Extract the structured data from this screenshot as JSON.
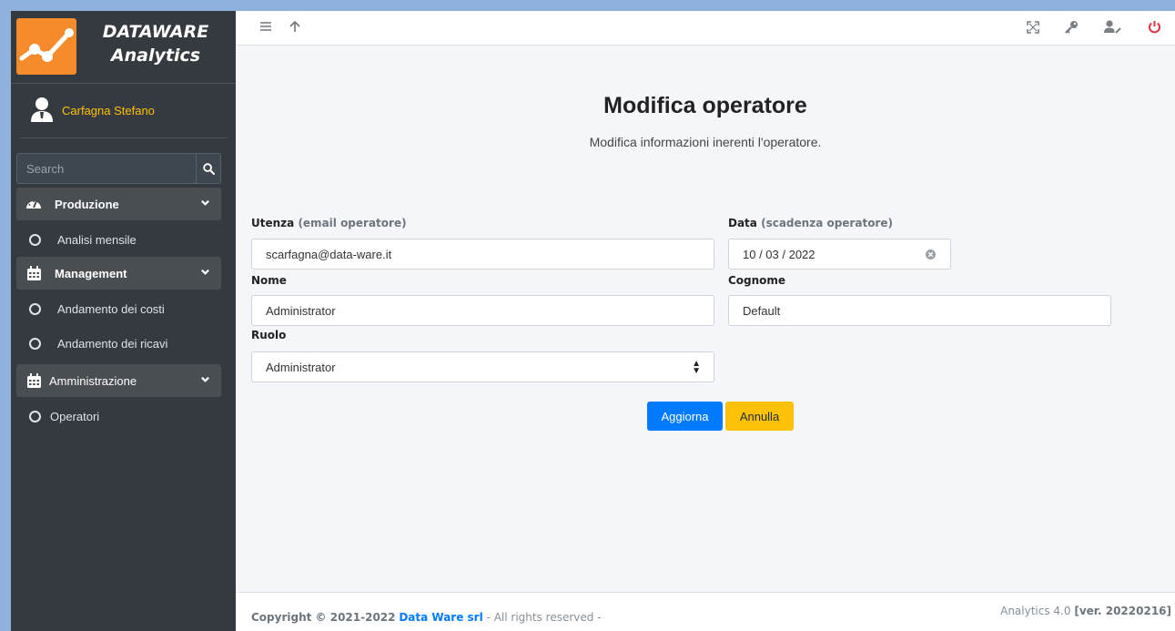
{
  "brand": {
    "line1": "DATAWARE",
    "line2": "Analytics"
  },
  "user": {
    "name": "Carfagna Stefano"
  },
  "search": {
    "placeholder": "Search"
  },
  "sidebar": {
    "sections": [
      {
        "label": "Produzione",
        "items": [
          "Analisi mensile"
        ]
      },
      {
        "label": "Management",
        "items": [
          "Andamento dei costi",
          "Andamento dei ricavi"
        ]
      },
      {
        "label": "Amministrazione",
        "items": [
          "Operatori"
        ]
      }
    ]
  },
  "topbar": {
    "icons": [
      "menu-icon",
      "arrow-up-icon",
      "fullscreen-icon",
      "key-icon",
      "user-edit-icon",
      "power-icon"
    ]
  },
  "page": {
    "title": "Modifica operatore",
    "subtitle": "Modifica informazioni inerenti l'operatore."
  },
  "form": {
    "utenza_label": "Utenza",
    "utenza_hint": "(email operatore)",
    "utenza_value": "scarfagna@data-ware.it",
    "data_label": "Data",
    "data_hint": "(scadenza operatore)",
    "data_value": "10 / 03 / 2022",
    "nome_label": "Nome",
    "nome_value": "Administrator",
    "cognome_label": "Cognome",
    "cognome_value": "Default",
    "ruolo_label": "Ruolo",
    "ruolo_value": "Administrator",
    "update_label": "Aggiorna",
    "cancel_label": "Annulla"
  },
  "footer": {
    "copyright": "Copyright © 2021-2022",
    "company": "Data Ware srl",
    "rights": "- All rights reserved -",
    "version_prefix": "Analytics 4.0",
    "version": "[ver. 20220216]"
  },
  "colors": {
    "sidebar_bg": "#343a40",
    "accent_primary": "#007bff",
    "accent_warning": "#ffc107",
    "power": "#dc3545"
  }
}
